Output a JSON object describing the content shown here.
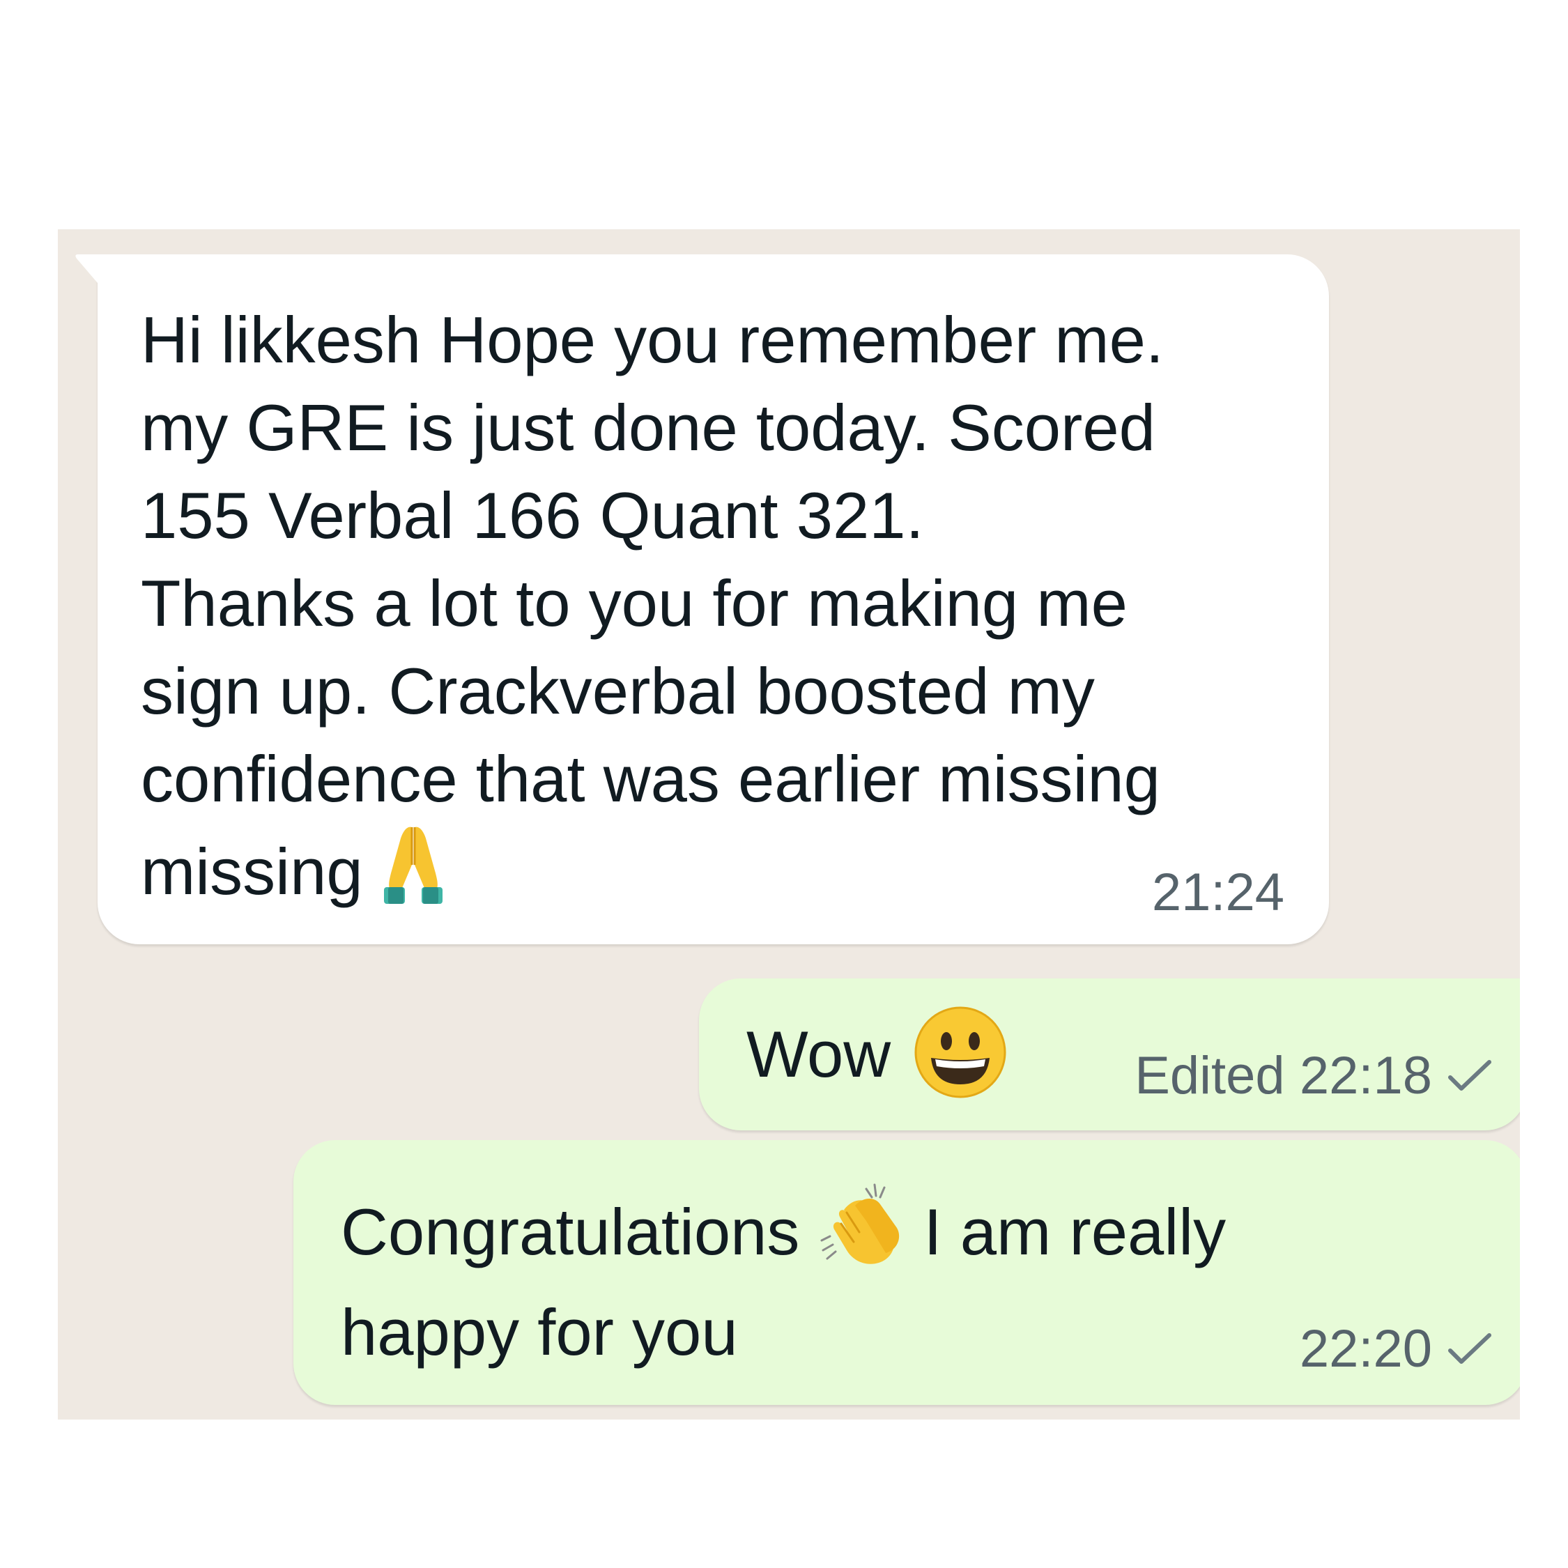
{
  "messages": [
    {
      "direction": "incoming",
      "text": "Hi likkesh Hope you remember me.\nmy GRE is just done today. Scored\n155 Verbal 166 Quant 321.\nThanks a lot to you for making me\nsign up. Crackverbal boosted my\nconfidence that was earlier missing\nmissing",
      "emoji": "folded-hands",
      "time": "21:24"
    },
    {
      "direction": "outgoing",
      "text": "Wow",
      "emoji": "grinning-face",
      "edited_label": "Edited 22:18",
      "status": "sent-check"
    },
    {
      "direction": "outgoing",
      "text_part1": "Congratulations",
      "emoji": "clapping-hands",
      "text_part2": " I am really\nhappy for you",
      "time": "22:20",
      "status": "sent-check"
    }
  ],
  "colors": {
    "chat_background": "#efe9e2",
    "incoming_bubble": "#ffffff",
    "outgoing_bubble": "#e7fbd8",
    "text": "#111b21",
    "meta_text": "#56636b"
  }
}
